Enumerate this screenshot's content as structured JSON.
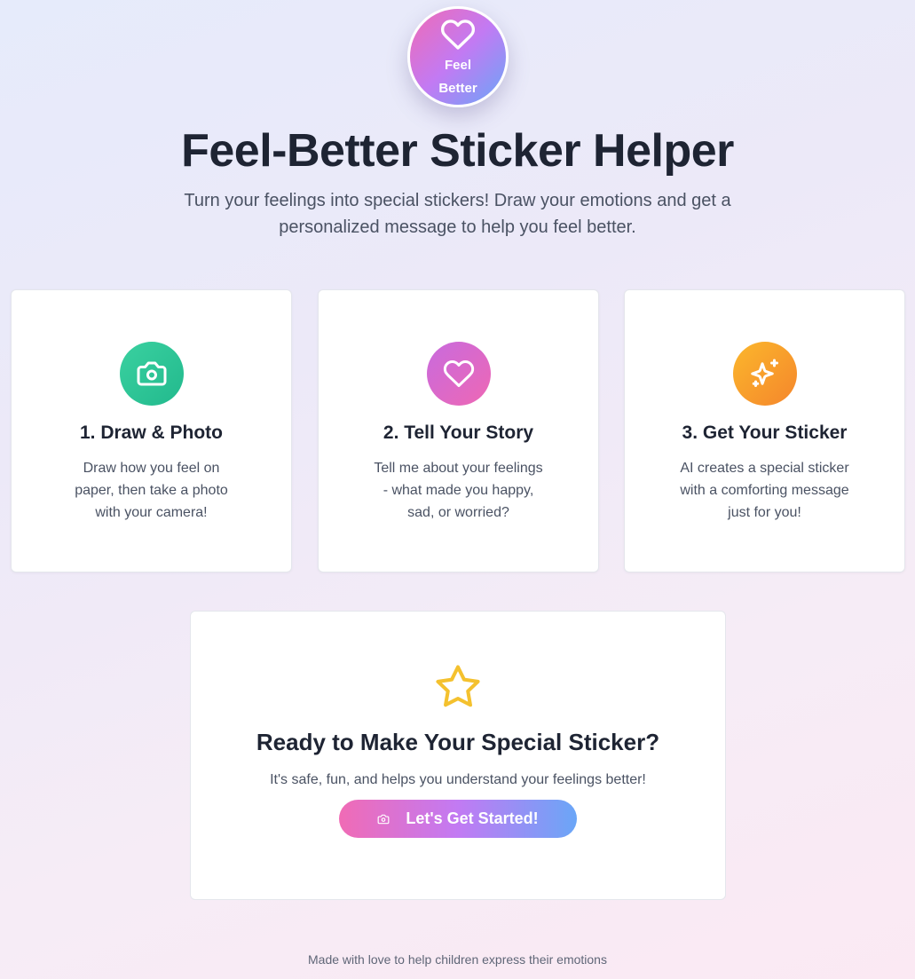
{
  "logo": {
    "icon": "heart-icon",
    "line1": "Feel",
    "line2": "Better"
  },
  "header": {
    "title": "Feel-Better Sticker Helper",
    "subtitle": "Turn your feelings into special stickers! Draw your emotions and get a personalized message to help you feel better."
  },
  "steps": [
    {
      "icon": "camera-icon",
      "color": "#2fc79a",
      "title": "1. Draw & Photo",
      "description": "Draw how you feel on paper, then take a photo with your camera!"
    },
    {
      "icon": "heart-icon",
      "color": "#d968c9",
      "title": "2. Tell Your Story",
      "description": "Tell me about your feelings - what made you happy, sad, or worried?"
    },
    {
      "icon": "sparkles-icon",
      "color": "#f7a02a",
      "title": "3. Get Your Sticker",
      "description": "AI creates a special sticker with a comforting message just for you!"
    }
  ],
  "cta": {
    "icon": "star-icon",
    "title": "Ready to Make Your Special Sticker?",
    "description": "It's safe, fun, and helps you understand your feelings better!",
    "button_label": "Let's Get Started!",
    "button_icon": "camera-icon"
  },
  "footer": {
    "text": "Made with love to help children express their emotions"
  },
  "colors": {
    "primary_gradient": [
      "#f06bb5",
      "#c27af3",
      "#6aa6f7"
    ],
    "star": "#f4c12e",
    "text_dark": "#1e2433",
    "text_muted": "#4a5263"
  }
}
